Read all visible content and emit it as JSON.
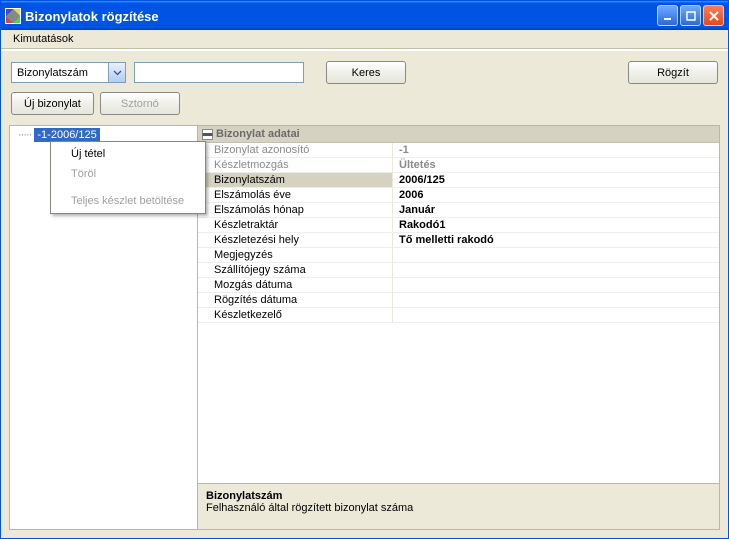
{
  "window": {
    "title": "Bizonylatok rögzítése"
  },
  "menubar": {
    "kimutatasok": "Kimutatások"
  },
  "toolbar": {
    "search_field_label": "Bizonylatszám",
    "search_value": "",
    "keres": "Keres",
    "rogzit": "Rögzít",
    "uj_bizonylat": "Új bizonylat",
    "sztorno": "Sztornó"
  },
  "tree": {
    "selected_node": "-1-2006/125"
  },
  "context_menu": {
    "uj_tetel": "Új tétel",
    "torol": "Töröl",
    "teljes": "Teljes készlet betöltése"
  },
  "propgrid": {
    "header": "Bizonylat adatai",
    "rows": [
      {
        "label": "Bizonylat azonosító",
        "value": "-1",
        "readonly": true
      },
      {
        "label": "Készletmozgás",
        "value": "Ültetés",
        "readonly": true
      },
      {
        "label": "Bizonylatszám",
        "value": "2006/125",
        "selected": true
      },
      {
        "label": "Elszámolás éve",
        "value": "2006"
      },
      {
        "label": "Elszámolás hónap",
        "value": "Január"
      },
      {
        "label": "Készletraktár",
        "value": "Rakodó1"
      },
      {
        "label": "Készletezési hely",
        "value": "Tő melletti rakodó"
      },
      {
        "label": "Megjegyzés",
        "value": ""
      },
      {
        "label": "Szállítójegy száma",
        "value": ""
      },
      {
        "label": "Mozgás dátuma",
        "value": ""
      },
      {
        "label": "Rögzítés dátuma",
        "value": ""
      },
      {
        "label": "Készletkezelő",
        "value": ""
      }
    ]
  },
  "description": {
    "title": "Bizonylatszám",
    "text": "Felhasználó által rögzített bizonylat száma"
  }
}
